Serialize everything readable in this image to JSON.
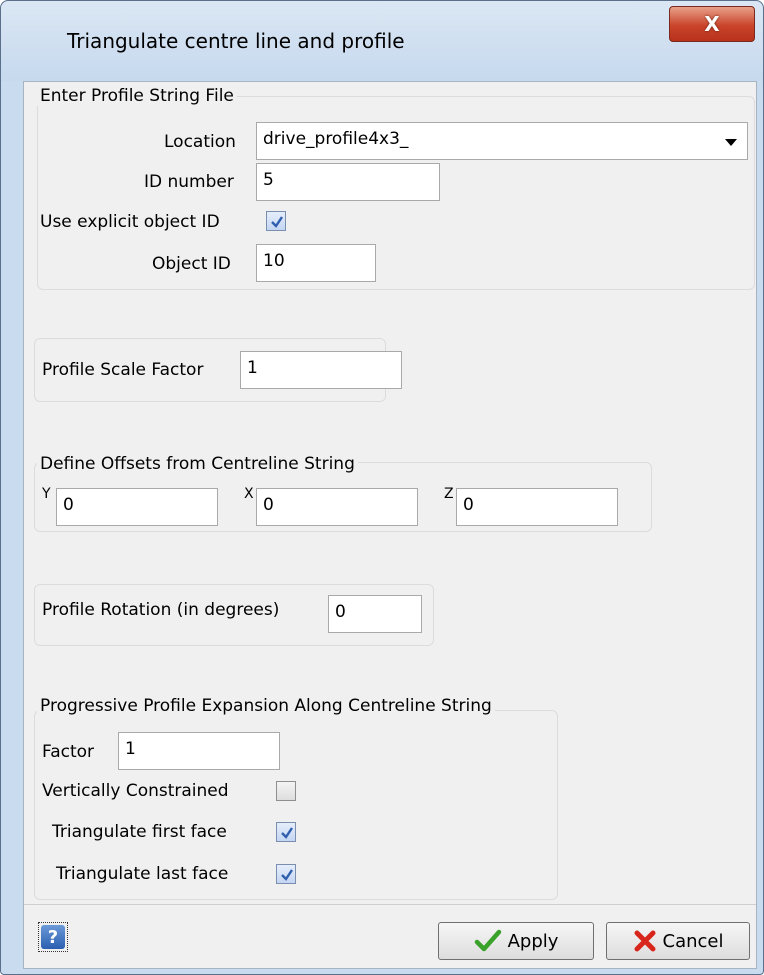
{
  "window": {
    "title": "Triangulate centre line and profile",
    "close_glyph": "X"
  },
  "profile_file": {
    "group_title": "Enter Profile String File",
    "location_label": "Location",
    "location_value": "drive_profile4x3_",
    "id_number_label": "ID number",
    "id_number_value": "5",
    "use_explicit_label": "Use explicit object ID",
    "use_explicit_checked": true,
    "object_id_label": "Object ID",
    "object_id_value": "10"
  },
  "scale": {
    "label": "Profile Scale Factor",
    "value": "1"
  },
  "offsets": {
    "group_title": "Define Offsets from Centreline String",
    "y_label": "Y",
    "y_value": "0",
    "x_label": "X",
    "x_value": "0",
    "z_label": "Z",
    "z_value": "0"
  },
  "rotation": {
    "label": "Profile Rotation (in degrees)",
    "value": "0"
  },
  "expansion": {
    "group_title": "Progressive Profile Expansion Along Centreline String",
    "factor_label": "Factor",
    "factor_value": "1",
    "vertically_constrained_label": "Vertically Constrained",
    "vertically_constrained_checked": false,
    "triangulate_first_label": "Triangulate first face",
    "triangulate_first_checked": true,
    "triangulate_last_label": "Triangulate last face",
    "triangulate_last_checked": true
  },
  "buttons": {
    "help_glyph": "?",
    "apply": "Apply",
    "cancel": "Cancel"
  },
  "colors": {
    "apply_check": "#3aa12b",
    "cancel_x": "#d8261c",
    "checkmark": "#2f5fae"
  }
}
